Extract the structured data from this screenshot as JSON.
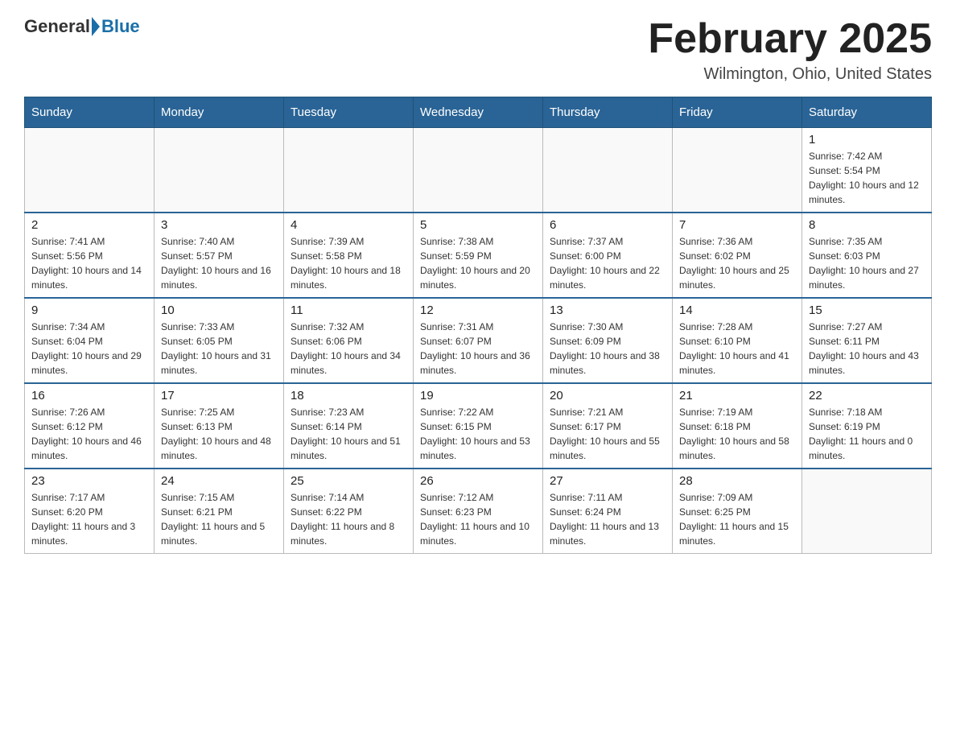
{
  "header": {
    "logo": {
      "part1": "General",
      "part2": "Blue"
    },
    "title": "February 2025",
    "subtitle": "Wilmington, Ohio, United States"
  },
  "weekdays": [
    "Sunday",
    "Monday",
    "Tuesday",
    "Wednesday",
    "Thursday",
    "Friday",
    "Saturday"
  ],
  "weeks": [
    [
      {
        "day": "",
        "info": ""
      },
      {
        "day": "",
        "info": ""
      },
      {
        "day": "",
        "info": ""
      },
      {
        "day": "",
        "info": ""
      },
      {
        "day": "",
        "info": ""
      },
      {
        "day": "",
        "info": ""
      },
      {
        "day": "1",
        "info": "Sunrise: 7:42 AM\nSunset: 5:54 PM\nDaylight: 10 hours and 12 minutes."
      }
    ],
    [
      {
        "day": "2",
        "info": "Sunrise: 7:41 AM\nSunset: 5:56 PM\nDaylight: 10 hours and 14 minutes."
      },
      {
        "day": "3",
        "info": "Sunrise: 7:40 AM\nSunset: 5:57 PM\nDaylight: 10 hours and 16 minutes."
      },
      {
        "day": "4",
        "info": "Sunrise: 7:39 AM\nSunset: 5:58 PM\nDaylight: 10 hours and 18 minutes."
      },
      {
        "day": "5",
        "info": "Sunrise: 7:38 AM\nSunset: 5:59 PM\nDaylight: 10 hours and 20 minutes."
      },
      {
        "day": "6",
        "info": "Sunrise: 7:37 AM\nSunset: 6:00 PM\nDaylight: 10 hours and 22 minutes."
      },
      {
        "day": "7",
        "info": "Sunrise: 7:36 AM\nSunset: 6:02 PM\nDaylight: 10 hours and 25 minutes."
      },
      {
        "day": "8",
        "info": "Sunrise: 7:35 AM\nSunset: 6:03 PM\nDaylight: 10 hours and 27 minutes."
      }
    ],
    [
      {
        "day": "9",
        "info": "Sunrise: 7:34 AM\nSunset: 6:04 PM\nDaylight: 10 hours and 29 minutes."
      },
      {
        "day": "10",
        "info": "Sunrise: 7:33 AM\nSunset: 6:05 PM\nDaylight: 10 hours and 31 minutes."
      },
      {
        "day": "11",
        "info": "Sunrise: 7:32 AM\nSunset: 6:06 PM\nDaylight: 10 hours and 34 minutes."
      },
      {
        "day": "12",
        "info": "Sunrise: 7:31 AM\nSunset: 6:07 PM\nDaylight: 10 hours and 36 minutes."
      },
      {
        "day": "13",
        "info": "Sunrise: 7:30 AM\nSunset: 6:09 PM\nDaylight: 10 hours and 38 minutes."
      },
      {
        "day": "14",
        "info": "Sunrise: 7:28 AM\nSunset: 6:10 PM\nDaylight: 10 hours and 41 minutes."
      },
      {
        "day": "15",
        "info": "Sunrise: 7:27 AM\nSunset: 6:11 PM\nDaylight: 10 hours and 43 minutes."
      }
    ],
    [
      {
        "day": "16",
        "info": "Sunrise: 7:26 AM\nSunset: 6:12 PM\nDaylight: 10 hours and 46 minutes."
      },
      {
        "day": "17",
        "info": "Sunrise: 7:25 AM\nSunset: 6:13 PM\nDaylight: 10 hours and 48 minutes."
      },
      {
        "day": "18",
        "info": "Sunrise: 7:23 AM\nSunset: 6:14 PM\nDaylight: 10 hours and 51 minutes."
      },
      {
        "day": "19",
        "info": "Sunrise: 7:22 AM\nSunset: 6:15 PM\nDaylight: 10 hours and 53 minutes."
      },
      {
        "day": "20",
        "info": "Sunrise: 7:21 AM\nSunset: 6:17 PM\nDaylight: 10 hours and 55 minutes."
      },
      {
        "day": "21",
        "info": "Sunrise: 7:19 AM\nSunset: 6:18 PM\nDaylight: 10 hours and 58 minutes."
      },
      {
        "day": "22",
        "info": "Sunrise: 7:18 AM\nSunset: 6:19 PM\nDaylight: 11 hours and 0 minutes."
      }
    ],
    [
      {
        "day": "23",
        "info": "Sunrise: 7:17 AM\nSunset: 6:20 PM\nDaylight: 11 hours and 3 minutes."
      },
      {
        "day": "24",
        "info": "Sunrise: 7:15 AM\nSunset: 6:21 PM\nDaylight: 11 hours and 5 minutes."
      },
      {
        "day": "25",
        "info": "Sunrise: 7:14 AM\nSunset: 6:22 PM\nDaylight: 11 hours and 8 minutes."
      },
      {
        "day": "26",
        "info": "Sunrise: 7:12 AM\nSunset: 6:23 PM\nDaylight: 11 hours and 10 minutes."
      },
      {
        "day": "27",
        "info": "Sunrise: 7:11 AM\nSunset: 6:24 PM\nDaylight: 11 hours and 13 minutes."
      },
      {
        "day": "28",
        "info": "Sunrise: 7:09 AM\nSunset: 6:25 PM\nDaylight: 11 hours and 15 minutes."
      },
      {
        "day": "",
        "info": ""
      }
    ]
  ]
}
